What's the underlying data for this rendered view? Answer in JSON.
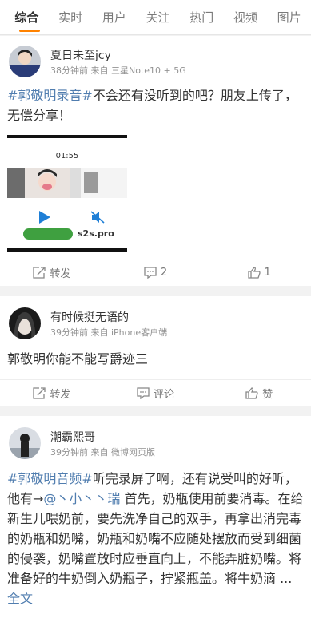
{
  "tabs": [
    {
      "label": "综合",
      "active": true
    },
    {
      "label": "实时"
    },
    {
      "label": "用户"
    },
    {
      "label": "关注"
    },
    {
      "label": "热门"
    },
    {
      "label": "视频"
    },
    {
      "label": "图片"
    }
  ],
  "posts": [
    {
      "username": "夏日未至jcy",
      "meta": "38分钟前 来自 三星Note10 + 5G",
      "hashtag": "#郭敬明录音#",
      "text": "不会还有没听到的吧？朋友上传了，无偿分享！",
      "video": {
        "time": "01:55",
        "watermark": "s2s.pro"
      },
      "actions": {
        "repost": "转发",
        "comment": "2",
        "like": "1"
      }
    },
    {
      "username": "有时候挺无语的",
      "meta": "39分钟前 来自 iPhone客户端",
      "text": "郭敬明你能不能写爵迹三",
      "actions": {
        "repost": "转发",
        "comment": "评论",
        "like": "赞"
      }
    },
    {
      "username": "潮霸熙哥",
      "meta": "39分钟前 来自 微博网页版",
      "hashtag": "#郭敬明音频#",
      "text_a": "听完录屏了啊，还有说受叫的好听，  他有→",
      "mention": "@丶小丶丶瑞",
      "text_b": " 首先，奶瓶使用前要消毒。在给新生儿喂奶前，要先洗净自己的双手，再拿出消完毒的奶瓶和奶嘴，奶瓶和奶嘴不应随处摆放而受到细菌的侵袭，奶嘴置放时应垂直向上，不能弄脏奶嘴。将准备好的牛奶倒入奶瓶子，拧紧瓶盖。将牛奶滴 ...",
      "more": "全文"
    }
  ],
  "colors": {
    "accent": "#ff8200",
    "topic": "#507daf"
  }
}
